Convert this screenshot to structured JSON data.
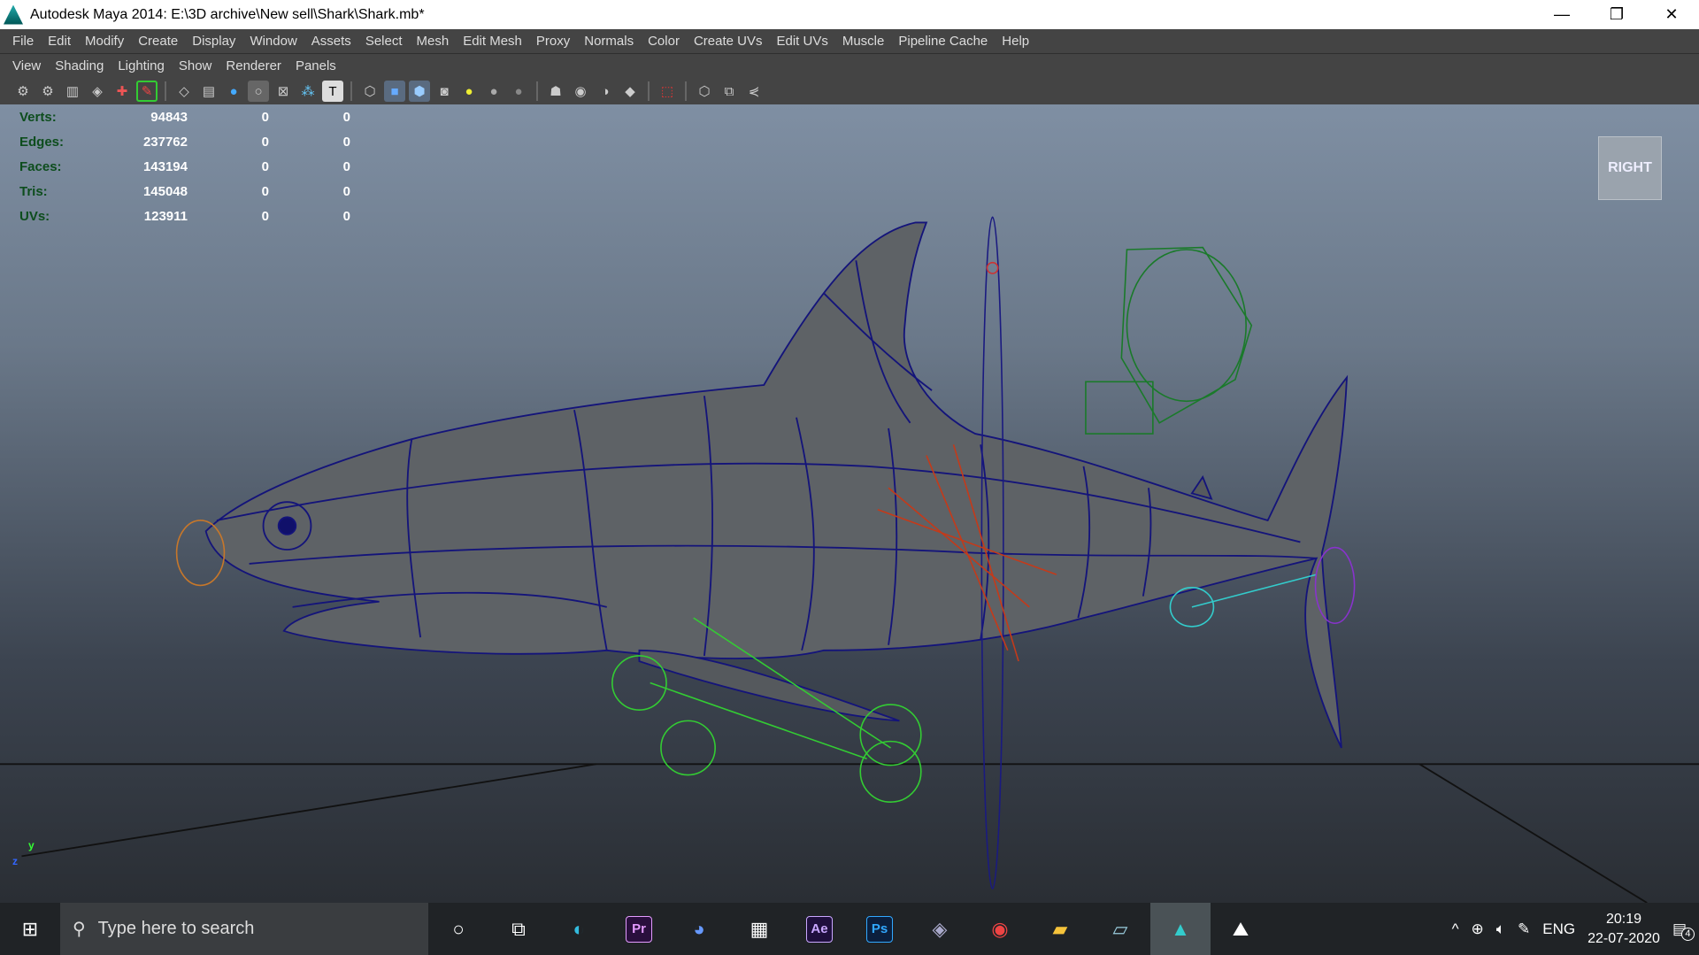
{
  "window": {
    "title": "Autodesk Maya 2014: E:\\3D archive\\New sell\\Shark\\Shark.mb*",
    "minimize": "—",
    "restore": "❐",
    "close": "✕"
  },
  "menu": [
    "File",
    "Edit",
    "Modify",
    "Create",
    "Display",
    "Window",
    "Assets",
    "Select",
    "Mesh",
    "Edit Mesh",
    "Proxy",
    "Normals",
    "Color",
    "Create UVs",
    "Edit UVs",
    "Muscle",
    "Pipeline Cache",
    "Help"
  ],
  "panel_menu": [
    "View",
    "Shading",
    "Lighting",
    "Show",
    "Renderer",
    "Panels"
  ],
  "hud": [
    {
      "label": "Verts:",
      "total": "94843",
      "sel": "0",
      "comp": "0"
    },
    {
      "label": "Edges:",
      "total": "237762",
      "sel": "0",
      "comp": "0"
    },
    {
      "label": "Faces:",
      "total": "143194",
      "sel": "0",
      "comp": "0"
    },
    {
      "label": "Tris:",
      "total": "145048",
      "sel": "0",
      "comp": "0"
    },
    {
      "label": "UVs:",
      "total": "123911",
      "sel": "0",
      "comp": "0"
    }
  ],
  "view_cube": "RIGHT",
  "axis": {
    "y": "y",
    "z": "z"
  },
  "taskbar": {
    "search_placeholder": "Type here to search",
    "apps": [
      {
        "name": "Pr",
        "color": "#2a0f3d",
        "fg": "#e49bff"
      },
      {
        "name": "Ae",
        "color": "#1f0f3d",
        "fg": "#c9a7ff"
      },
      {
        "name": "Ps",
        "color": "#0b1f3d",
        "fg": "#31a8ff"
      }
    ],
    "lang": "ENG",
    "time": "20:19",
    "date": "22-07-2020",
    "notifications": "4"
  }
}
